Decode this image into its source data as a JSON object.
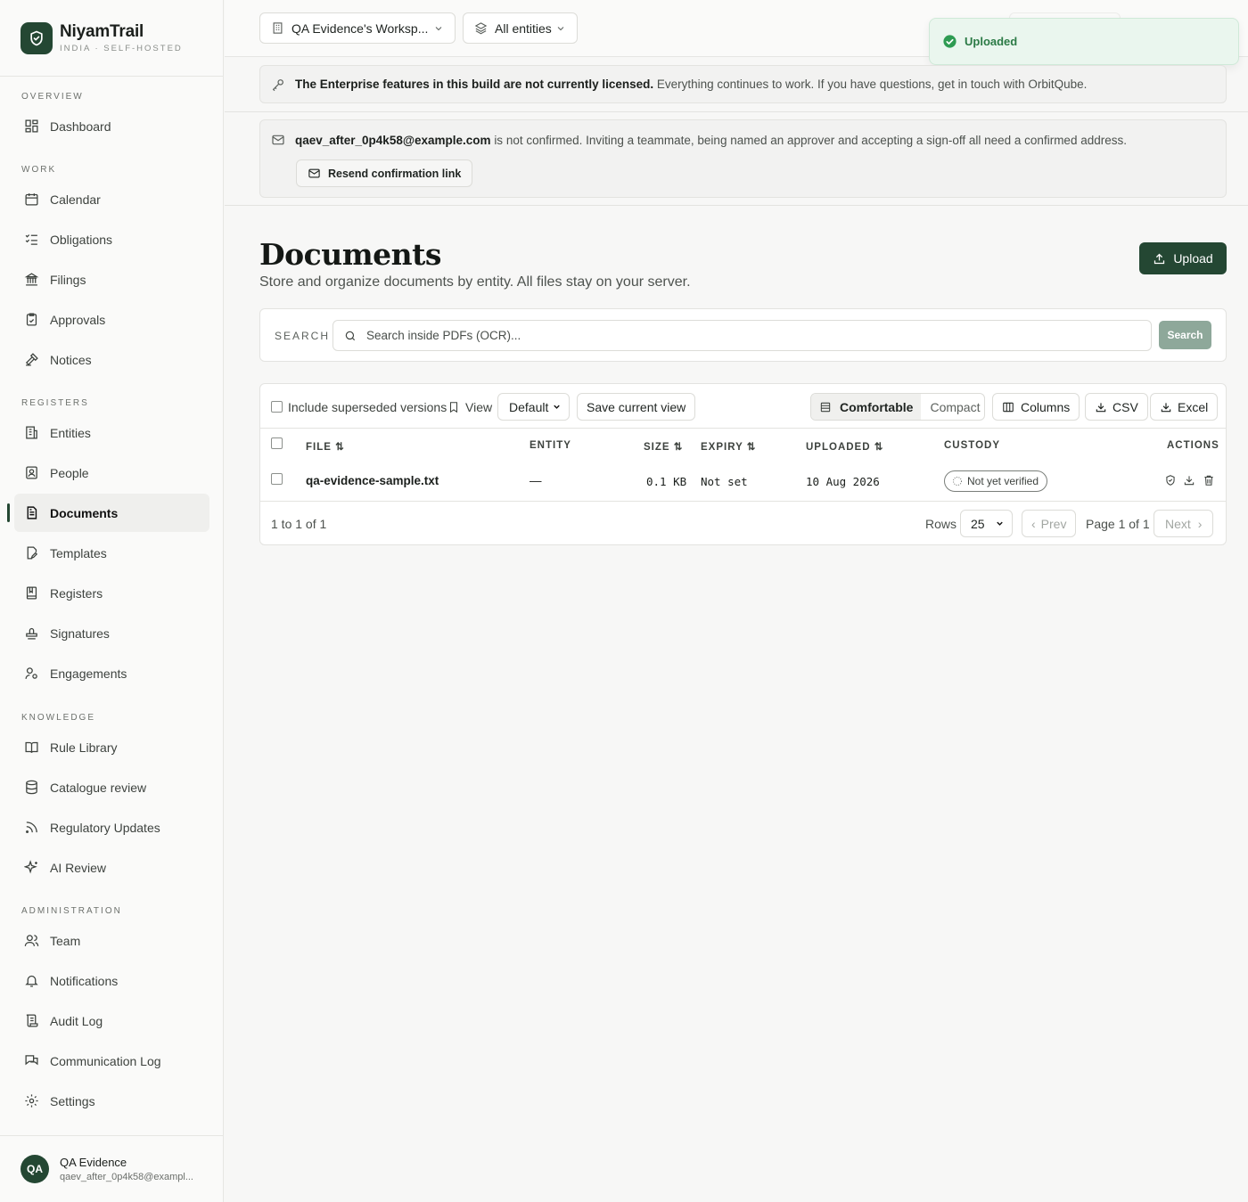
{
  "brand": {
    "name": "NiyamTrail",
    "tagline": "INDIA · SELF-HOSTED"
  },
  "sidebar": {
    "sections": [
      {
        "label": "OVERVIEW",
        "items": [
          {
            "label": "Dashboard",
            "icon": "dashboard-icon"
          }
        ]
      },
      {
        "label": "WORK",
        "items": [
          {
            "label": "Calendar",
            "icon": "calendar-icon"
          },
          {
            "label": "Obligations",
            "icon": "checklist-icon"
          },
          {
            "label": "Filings",
            "icon": "landmark-icon"
          },
          {
            "label": "Approvals",
            "icon": "clipboard-check-icon"
          },
          {
            "label": "Notices",
            "icon": "gavel-icon"
          }
        ]
      },
      {
        "label": "REGISTERS",
        "items": [
          {
            "label": "Entities",
            "icon": "building-icon"
          },
          {
            "label": "People",
            "icon": "person-badge-icon"
          },
          {
            "label": "Documents",
            "icon": "document-icon",
            "active": true
          },
          {
            "label": "Templates",
            "icon": "file-pen-icon"
          },
          {
            "label": "Registers",
            "icon": "book-icon"
          },
          {
            "label": "Signatures",
            "icon": "stamp-icon"
          },
          {
            "label": "Engagements",
            "icon": "user-cog-icon"
          }
        ]
      },
      {
        "label": "KNOWLEDGE",
        "items": [
          {
            "label": "Rule Library",
            "icon": "open-book-icon"
          },
          {
            "label": "Catalogue review",
            "icon": "database-icon"
          },
          {
            "label": "Regulatory Updates",
            "icon": "rss-icon"
          },
          {
            "label": "AI Review",
            "icon": "sparkles-icon"
          }
        ]
      },
      {
        "label": "ADMINISTRATION",
        "items": [
          {
            "label": "Team",
            "icon": "users-icon"
          },
          {
            "label": "Notifications",
            "icon": "bell-icon"
          },
          {
            "label": "Audit Log",
            "icon": "scroll-icon"
          },
          {
            "label": "Communication Log",
            "icon": "chat-icon"
          },
          {
            "label": "Settings",
            "icon": "gear-icon"
          }
        ]
      }
    ]
  },
  "user": {
    "initials": "QA",
    "name": "QA Evidence",
    "email": "qaev_after_0p4k58@exampl..."
  },
  "topbar": {
    "workspace": "QA Evidence's Worksp...",
    "entities": "All entities"
  },
  "toast": {
    "text": "Uploaded",
    "color": "#2b7a45"
  },
  "license_banner": {
    "bold": "The Enterprise features in this build are not currently licensed.",
    "rest": "Everything continues to work. If you have questions, get in touch with OrbitQube."
  },
  "confirm_banner": {
    "email": "qaev_after_0p4k58@example.com",
    "rest": "is not confirmed. Inviting a teammate, being named an approver and accepting a sign-off all need a confirmed address.",
    "button": "Resend confirmation link"
  },
  "page": {
    "title": "Documents",
    "subtitle": "Store and organize documents by entity. All files stay on your server.",
    "upload_label": "Upload",
    "accent": "#244733"
  },
  "search": {
    "label": "SEARCH",
    "placeholder": "Search inside PDFs (OCR)...",
    "button": "Search"
  },
  "toolbar": {
    "include_superseded": "Include superseded versions",
    "view_label": "View",
    "view_value": "Default",
    "save_view": "Save current view",
    "density_comfortable": "Comfortable",
    "density_compact": "Compact",
    "columns": "Columns",
    "csv": "CSV",
    "excel": "Excel"
  },
  "table": {
    "headers": {
      "file": "FILE",
      "entity": "ENTITY",
      "size": "SIZE",
      "expiry": "EXPIRY",
      "uploaded": "UPLOADED",
      "custody": "CUSTODY",
      "actions": "ACTIONS"
    },
    "rows": [
      {
        "file": "qa-evidence-sample.txt",
        "entity": "—",
        "size": "0.1 KB",
        "expiry": "Not set",
        "uploaded": "10 Aug 2026",
        "custody": "Not yet verified"
      }
    ]
  },
  "pagination": {
    "summary": "1 to 1 of 1",
    "rows_label": "Rows",
    "rows_value": "25",
    "prev": "Prev",
    "page": "Page 1 of 1",
    "next": "Next"
  }
}
